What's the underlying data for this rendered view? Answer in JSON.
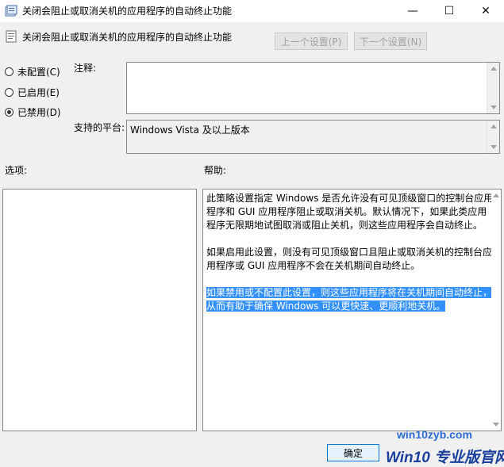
{
  "window": {
    "title": "关闭会阻止或取消关机的应用程序的自动终止功能",
    "minimize_glyph": "—",
    "maximize_glyph": "☐",
    "close_glyph": "✕"
  },
  "header": {
    "policy_name": "关闭会阻止或取消关机的应用程序的自动终止功能",
    "prev_label": "上一个设置(P)",
    "next_label": "下一个设置(N)"
  },
  "state": {
    "options": [
      {
        "label": "未配置(C)",
        "selected": false
      },
      {
        "label": "已启用(E)",
        "selected": false
      },
      {
        "label": "已禁用(D)",
        "selected": true
      }
    ]
  },
  "comment": {
    "label": "注释:",
    "value": ""
  },
  "supported": {
    "label": "支持的平台:",
    "value": "Windows Vista 及以上版本"
  },
  "options_panel": {
    "label": "选项:"
  },
  "help": {
    "label": "帮助:",
    "paragraphs": [
      "此策略设置指定 Windows 是否允许没有可见顶级窗口的控制台应用程序和 GUI 应用程序阻止或取消关机。默认情况下，如果此类应用程序无限期地试图取消或阻止关机，则这些应用程序会自动终止。",
      "如果启用此设置，则没有可见顶级窗口且阻止或取消关机的控制台应用程序或 GUI 应用程序不会在关机期间自动终止。",
      "如果禁用或不配置此设置，则这些应用程序将在关机期间自动终止，从而有助于确保 Windows 可以更快速、更顺利地关机。"
    ]
  },
  "footer": {
    "ok_label": "确定"
  },
  "watermark": {
    "line1": "win10zyb.com",
    "line2": "Win10 专业版官网"
  },
  "colors": {
    "selection": "#3390ff",
    "accent": "#0078d7",
    "watermark": "#1a3f9c"
  }
}
